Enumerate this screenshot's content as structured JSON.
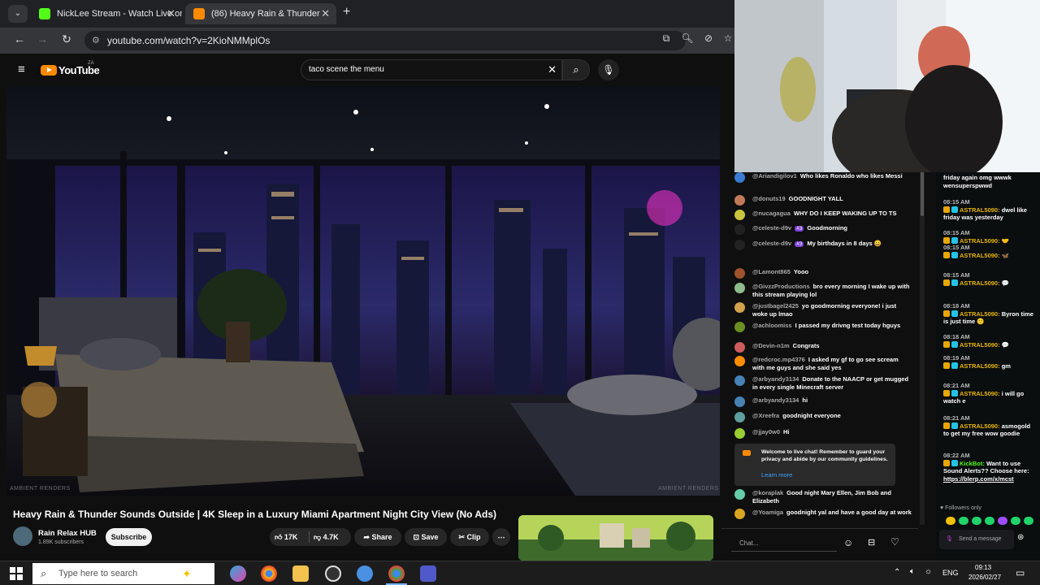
{
  "tabs": [
    {
      "label": "NickLee Stream - Watch Live on",
      "fav_color": "#53fc18"
    },
    {
      "label": "(86) Heavy Rain & Thunder",
      "fav_color": "#ff0033"
    }
  ],
  "address": {
    "url": "youtube.com/watch?v=2KioNMMplOs"
  },
  "youtube": {
    "logo": "YouTube",
    "country": "ZA",
    "search_value": "taco scene the menu",
    "video_title": "Heavy Rain & Thunder Sounds Outside | 4K Sleep in a Luxury Miami Apartment Night City View (No Ads)",
    "channel_name": "Rain Relax HUB",
    "subscribers": "1.89K subscribers",
    "subscribe_label": "Subscribe",
    "likes": "17K",
    "dislikes": "4.7K",
    "share_label": "Share",
    "save_label": "Save",
    "clip_label": "Clip",
    "watermark_left": "AMBIENT RENDERS",
    "watermark_right": "AMBIENT RENDERS"
  },
  "yt_chat": {
    "messages": [
      {
        "author": "@Ariandigilov1",
        "text": "Who likes Ronaldo who likes Messi",
        "color": "#3a7bd5"
      },
      {
        "author": "@donuts19",
        "text": "GOODNIGHT YALL",
        "color": "#c07a5a"
      },
      {
        "author": "@nucagagua",
        "text": "WHY DO I KEEP WAKING UP TO TS",
        "color": "#c9c33d"
      },
      {
        "author": "@celeste-d9v",
        "badge": "#3",
        "text": "Goodmorning",
        "color": "#222"
      },
      {
        "author": "@celeste-d9v",
        "badge": "#3",
        "text": "My birthdays in 8 days 😀",
        "color": "#222"
      },
      {
        "author": "@Lamont865",
        "text": "Yooo",
        "color": "#a0522d"
      },
      {
        "author": "@GivzzProductions",
        "text": "bro every morning I wake up with this stream playing lol",
        "color": "#8fbc8f"
      },
      {
        "author": "@justbagel2425",
        "text": "yo goodmorning everyone! i just woke up lmao",
        "color": "#d2a24c"
      },
      {
        "author": "@achloomiss",
        "text": "I passed my drivng test today hguys",
        "color": "#6b8e23"
      },
      {
        "author": "@Devin-n1m",
        "text": "Congrats",
        "color": "#cd5c5c"
      },
      {
        "author": "@redcroc.mp4376",
        "text": "I asked my gf to go see scream with me guys and she said yes",
        "color": "#ff8c00"
      },
      {
        "author": "@arbyandy3134",
        "text": "Donate to the NAACP or get mugged in every single Minecraft server",
        "color": "#4682b4"
      },
      {
        "author": "@arbyandy3134",
        "text": "hi",
        "color": "#4682b4"
      },
      {
        "author": "@Xreefra",
        "text": "goodnight everyone",
        "color": "#5f9ea0"
      },
      {
        "author": "@jjay0w0",
        "text": "Hi",
        "color": "#9acd32"
      }
    ],
    "notice": "Welcome to live chat! Remember to guard your privacy and abide by our community guidelines.",
    "notice_link": "Learn more",
    "messages_after": [
      {
        "author": "@koraplak",
        "text": "Good night Mary Ellen, Jim Bob and Elizabeth",
        "color": "#66cdaa"
      },
      {
        "author": "@Yoamiga",
        "text": "goodnight yal and have a good day at work",
        "color": "#daa520"
      }
    ],
    "input_placeholder": "Chat..."
  },
  "kick_chat": {
    "top_text": "friday again omg wwwk wensuperspwwd",
    "messages": [
      {
        "time": "08:15 AM",
        "user": "ASTRAL5090:",
        "text": "dwel like friday was yesterday"
      },
      {
        "time": "08:15 AM",
        "user": "ASTRAL5090:",
        "text": "🤝"
      },
      {
        "time": "08:15 AM",
        "user": "ASTRAL5090:",
        "text": "🦋"
      },
      {
        "time": "08:15 AM",
        "user": "ASTRAL5090:",
        "text": "💬"
      },
      {
        "time": "08:18 AM",
        "user": "ASTRAL5090:",
        "text": "Byron time is just time 🙂"
      },
      {
        "time": "08:18 AM",
        "user": "ASTRAL5090:",
        "text": "💬"
      },
      {
        "time": "08:19 AM",
        "user": "ASTRAL5090:",
        "text": "gm"
      },
      {
        "time": "08:21 AM",
        "user": "ASTRAL5090:",
        "text": "i will go watch e"
      },
      {
        "time": "08:21 AM",
        "user": "ASTRAL5090:",
        "text": "asmogold to get my free wow goodie"
      },
      {
        "time": "08:22 AM",
        "user": "KickBot:",
        "text": "Want to use Sound Alerts?? Choose here:",
        "link": "https://blerp.com/x/mcst"
      }
    ],
    "followers_only": "Followers only",
    "send_placeholder": "Send a message"
  },
  "taskbar": {
    "search_placeholder": "Type here to search",
    "lang": "ENG",
    "time": "09:13",
    "date": "2026/02/27"
  }
}
